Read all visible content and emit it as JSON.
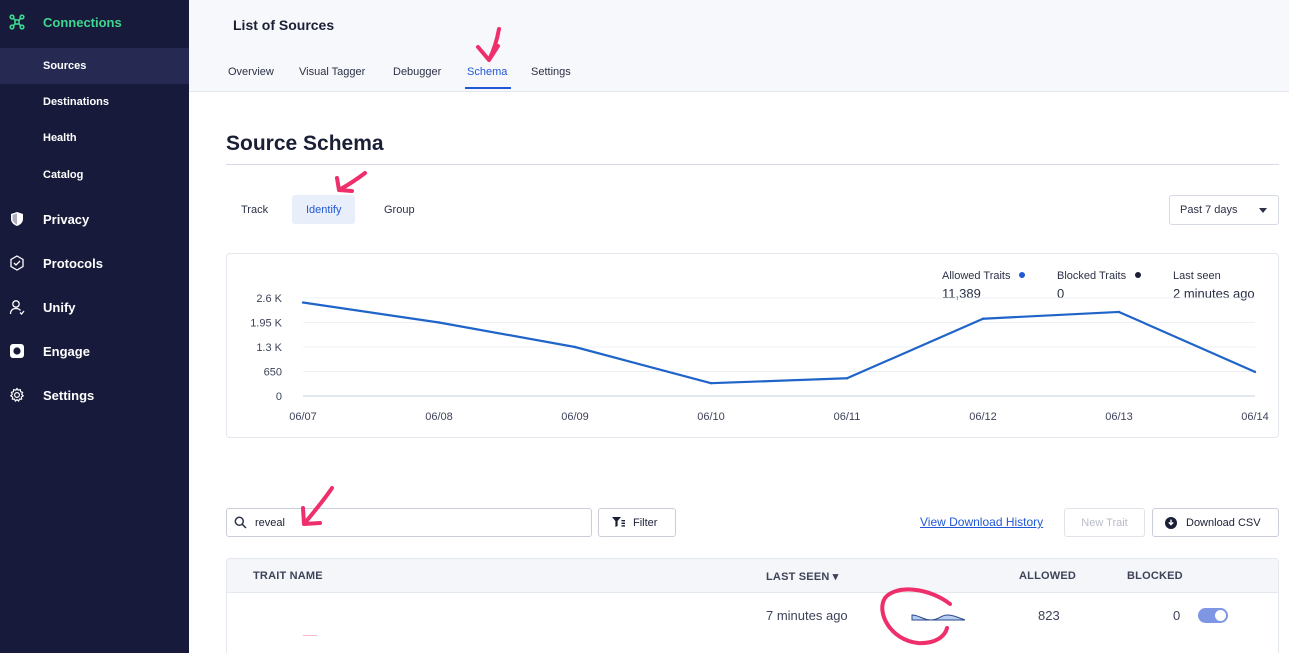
{
  "sidebar": {
    "connections": "Connections",
    "sub_items": [
      "Sources",
      "Destinations",
      "Health",
      "Catalog"
    ],
    "items": [
      "Privacy",
      "Protocols",
      "Unify",
      "Engage",
      "Settings"
    ]
  },
  "header": {
    "title": "List of Sources",
    "tabs": [
      "Overview",
      "Visual Tagger",
      "Debugger",
      "Schema",
      "Settings"
    ]
  },
  "page": {
    "title": "Source Schema",
    "subtabs": [
      "Track",
      "Identify",
      "Group"
    ],
    "range": "Past 7 days"
  },
  "stats": {
    "allowed_label": "Allowed Traits",
    "allowed_value": "11,389",
    "blocked_label": "Blocked Traits",
    "blocked_value": "0",
    "last_label": "Last seen",
    "last_value": "2 minutes ago"
  },
  "chart_data": {
    "type": "line",
    "x": [
      "06/07",
      "06/08",
      "06/09",
      "06/10",
      "06/11",
      "06/12",
      "06/13",
      "06/14"
    ],
    "y_ticks": [
      "2.6 K",
      "1.95 K",
      "1.3 K",
      "650",
      "0"
    ],
    "ylim": [
      0,
      2600
    ],
    "series": [
      {
        "values": [
          2480,
          1950,
          1300,
          340,
          470,
          2050,
          2230,
          640
        ]
      }
    ],
    "colors": {
      "line": "#1f64c8",
      "grid": "#eef0f4",
      "axis": "#e3e7ee"
    }
  },
  "toolbar": {
    "search_value": "reveal",
    "filter_label": "Filter",
    "history_link": "View Download History",
    "new_trait_label": "New Trait",
    "download_label": "Download CSV"
  },
  "table": {
    "columns": [
      "TRAIT NAME",
      "LAST SEEN ▾",
      "ALLOWED",
      "BLOCKED"
    ],
    "rows": [
      {
        "last_seen": "7 minutes ago",
        "allowed": "823",
        "blocked": "0"
      }
    ]
  },
  "colors": {
    "accent": "#2158d6",
    "sidebar": "#171a3b",
    "active_nav": "#3fd68f",
    "annotation": "#ee2f6b"
  }
}
